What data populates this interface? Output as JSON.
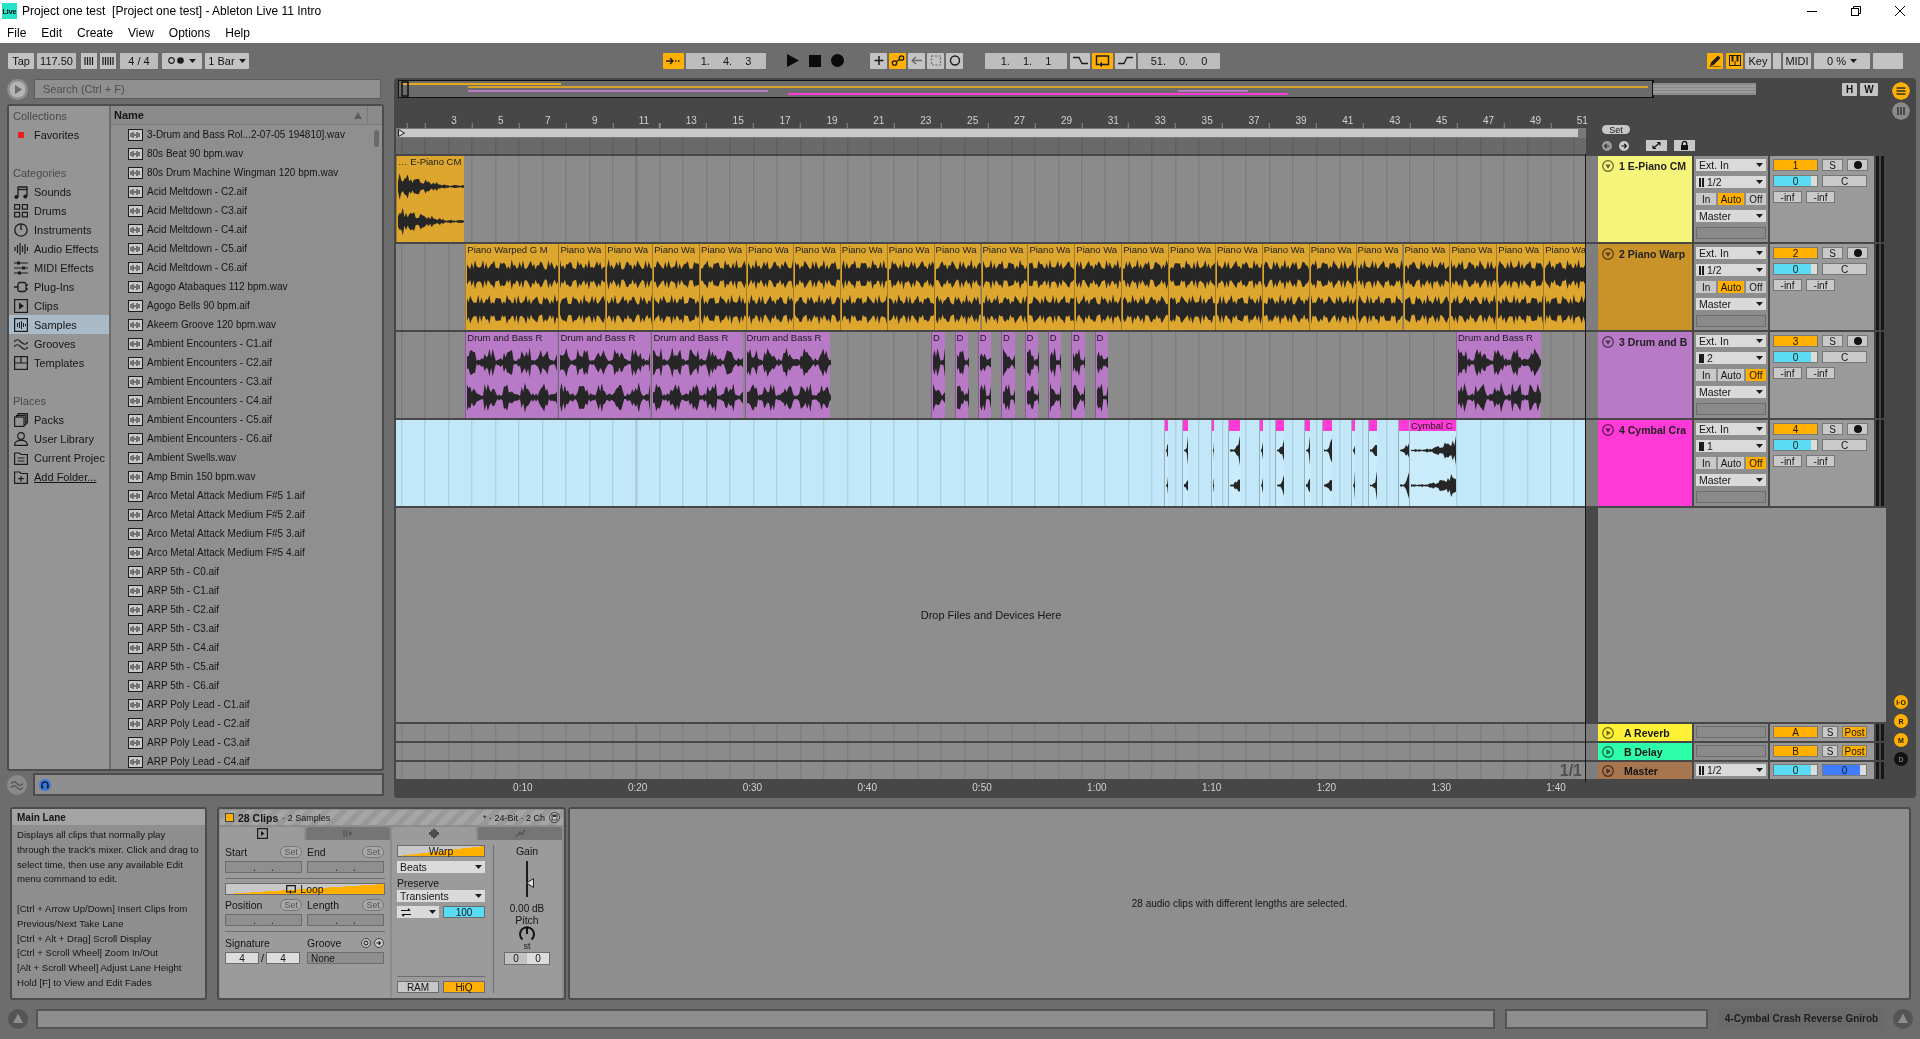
{
  "window": {
    "icon_label": "Live",
    "title": "Project one test  [Project one test] - Ableton Live 11 Intro"
  },
  "menu": [
    "File",
    "Edit",
    "Create",
    "View",
    "Options",
    "Help"
  ],
  "control_bar": {
    "tap": "Tap",
    "tempo": "117.50",
    "signature": "4 / 4",
    "metronome": false,
    "quantization": "1 Bar",
    "follow": true,
    "position": "1. 4. 3",
    "record_options": [
      {
        "kind": "overdub",
        "on": false
      },
      {
        "kind": "automation-arm",
        "on": true
      },
      {
        "kind": "re-enable",
        "on": false
      },
      {
        "kind": "capture",
        "on": false
      },
      {
        "kind": "session-record",
        "on": false
      }
    ],
    "loop_start": "1. 1. 1",
    "punch_in": false,
    "loop": true,
    "punch_out": false,
    "loop_length": "51. 0. 0",
    "draw_mode": true,
    "computer_keyboard": true,
    "key_map": {
      "label": "Key",
      "on": false
    },
    "midi_map": {
      "label": "MIDI",
      "on": false
    },
    "cpu": "0 %"
  },
  "browser": {
    "search": {
      "placeholder": "Search (Ctrl + F)"
    },
    "groups": [
      {
        "heading": "Collections",
        "items": [
          {
            "label": "Favorites",
            "kind": "collection",
            "color": "#ee1c1c",
            "selected": false
          }
        ]
      },
      {
        "heading": "Categories",
        "items": [
          {
            "label": "Sounds",
            "kind": "sounds",
            "selected": false
          },
          {
            "label": "Drums",
            "kind": "drums",
            "selected": false
          },
          {
            "label": "Instruments",
            "kind": "instruments",
            "selected": false
          },
          {
            "label": "Audio Effects",
            "kind": "audio-effects",
            "selected": false
          },
          {
            "label": "MIDI Effects",
            "kind": "midi-effects",
            "selected": false
          },
          {
            "label": "Plug-Ins",
            "kind": "plugins",
            "selected": false
          },
          {
            "label": "Clips",
            "kind": "clips",
            "selected": false
          },
          {
            "label": "Samples",
            "kind": "samples",
            "selected": true
          },
          {
            "label": "Grooves",
            "kind": "grooves",
            "selected": false
          },
          {
            "label": "Templates",
            "kind": "templates",
            "selected": false
          }
        ]
      },
      {
        "heading": "Places",
        "items": [
          {
            "label": "Packs",
            "kind": "packs",
            "selected": false
          },
          {
            "label": "User Library",
            "kind": "user",
            "selected": false
          },
          {
            "label": "Current Projec",
            "kind": "project",
            "selected": false
          },
          {
            "label": "Add Folder...",
            "kind": "add-folder",
            "selected": false
          }
        ]
      }
    ],
    "column": "Name",
    "files": [
      {
        "name": "3-Drum and Bass Rol...2-07-05 194810].wav",
        "selected": false
      },
      {
        "name": "80s Beat 90 bpm.wav",
        "selected": false
      },
      {
        "name": "80s Drum Machine Wingman 120 bpm.wav",
        "selected": false
      },
      {
        "name": "Acid Meltdown - C2.aif",
        "selected": false
      },
      {
        "name": "Acid Meltdown - C3.aif",
        "selected": false
      },
      {
        "name": "Acid Meltdown - C4.aif",
        "selected": false
      },
      {
        "name": "Acid Meltdown - C5.aif",
        "selected": false
      },
      {
        "name": "Acid Meltdown - C6.aif",
        "selected": false
      },
      {
        "name": "Agogo Atabaques 112 bpm.wav",
        "selected": false
      },
      {
        "name": "Agogo Bells 90 bpm.aif",
        "selected": false
      },
      {
        "name": "Akeem Groove 120 bpm.wav",
        "selected": false
      },
      {
        "name": "Ambient Encounters - C1.aif",
        "selected": false
      },
      {
        "name": "Ambient Encounters - C2.aif",
        "selected": false
      },
      {
        "name": "Ambient Encounters - C3.aif",
        "selected": false
      },
      {
        "name": "Ambient Encounters - C4.aif",
        "selected": false
      },
      {
        "name": "Ambient Encounters - C5.aif",
        "selected": false
      },
      {
        "name": "Ambient Encounters - C6.aif",
        "selected": false
      },
      {
        "name": "Ambient Swells.wav",
        "selected": false
      },
      {
        "name": "Amp Bmin 150 bpm.wav",
        "selected": false
      },
      {
        "name": "Arco Metal Attack Medium F#5 1.aif",
        "selected": false
      },
      {
        "name": "Arco Metal Attack Medium F#5 2.aif",
        "selected": false
      },
      {
        "name": "Arco Metal Attack Medium F#5 3.aif",
        "selected": false
      },
      {
        "name": "Arco Metal Attack Medium F#5 4.aif",
        "selected": false
      },
      {
        "name": "ARP 5th - C0.aif",
        "selected": false
      },
      {
        "name": "ARP 5th - C1.aif",
        "selected": false
      },
      {
        "name": "ARP 5th - C2.aif",
        "selected": false
      },
      {
        "name": "ARP 5th - C3.aif",
        "selected": false
      },
      {
        "name": "ARP 5th - C4.aif",
        "selected": false
      },
      {
        "name": "ARP 5th - C5.aif",
        "selected": false
      },
      {
        "name": "ARP 5th - C6.aif",
        "selected": false
      },
      {
        "name": "ARP Poly Lead - C1.aif",
        "selected": false
      },
      {
        "name": "ARP Poly Lead - C2.aif",
        "selected": false
      },
      {
        "name": "ARP Poly Lead - C3.aif",
        "selected": false
      },
      {
        "name": "ARP Poly Lead - C4.aif",
        "selected": false
      }
    ]
  },
  "arrangement": {
    "overview_buttons": [
      "H",
      "W"
    ],
    "set_button": "Set",
    "ruler": [
      "3",
      "5",
      "7",
      "9",
      "11",
      "13",
      "15",
      "17",
      "19",
      "21",
      "23",
      "25",
      "27",
      "29",
      "31",
      "33",
      "35",
      "37",
      "39",
      "41",
      "43",
      "45",
      "47",
      "49",
      "51"
    ],
    "tracks": [
      {
        "name": "1 E-Piano CM",
        "color": "#f7f47c",
        "selected": false,
        "clips": [
          {
            "name": "… E-Piano CM",
            "color": "#dca62f",
            "selected": false
          }
        ],
        "input_type": "Ext. In",
        "input_channel": "1/2",
        "stereo": true,
        "monitor": [
          {
            "label": "In",
            "selected": false
          },
          {
            "label": "Auto",
            "selected": true
          },
          {
            "label": "Off",
            "selected": false
          }
        ],
        "output": "Master",
        "number": "1",
        "active": true,
        "solo": {
          "label": "S",
          "on": false
        },
        "arm": false,
        "volume": {
          "reading": "0",
          "level": 0.85
        },
        "pan": "C",
        "sends": [
          "-inf",
          "-inf"
        ]
      },
      {
        "name": "2 Piano Warp",
        "color": "#c9932a",
        "selected": false,
        "clips": [
          {
            "name": "Piano Warped G M",
            "color": "#dca62f",
            "selected": false
          },
          {
            "name": "Piano Wa",
            "color": "#dca62f",
            "selected": false
          },
          {
            "name": "Piano Wa",
            "color": "#dca62f",
            "selected": false
          },
          {
            "name": "Piano Wa",
            "color": "#dca62f",
            "selected": false
          },
          {
            "name": "Piano Wa",
            "color": "#dca62f",
            "selected": false
          },
          {
            "name": "Piano Wa",
            "color": "#dca62f",
            "selected": false
          },
          {
            "name": "Piano Wa",
            "color": "#dca62f",
            "selected": false
          },
          {
            "name": "Piano Wa",
            "color": "#dca62f",
            "selected": false
          },
          {
            "name": "Piano Wa",
            "color": "#dca62f",
            "selected": false
          },
          {
            "name": "Piano Wa",
            "color": "#dca62f",
            "selected": false
          },
          {
            "name": "Piano Wa",
            "color": "#dca62f",
            "selected": false
          },
          {
            "name": "Piano Wa",
            "color": "#dca62f",
            "selected": false
          },
          {
            "name": "Piano Wa",
            "color": "#dca62f",
            "selected": false
          },
          {
            "name": "Piano Wa",
            "color": "#dca62f",
            "selected": false
          },
          {
            "name": "Piano Wa",
            "color": "#dca62f",
            "selected": false
          },
          {
            "name": "Piano Wa",
            "color": "#dca62f",
            "selected": false
          },
          {
            "name": "Piano Wa",
            "color": "#dca62f",
            "selected": false
          },
          {
            "name": "Piano Wa",
            "color": "#dca62f",
            "selected": false
          },
          {
            "name": "Piano Wa",
            "color": "#dca62f",
            "selected": false
          },
          {
            "name": "Piano Wa",
            "color": "#dca62f",
            "selected": false
          },
          {
            "name": "Piano Wa",
            "color": "#dca62f",
            "selected": false
          },
          {
            "name": "Piano Wa",
            "color": "#dca62f",
            "selected": false
          },
          {
            "name": "Piano Wa",
            "color": "#dca62f",
            "selected": false
          }
        ],
        "input_type": "Ext. In",
        "input_channel": "1/2",
        "stereo": true,
        "monitor": [
          {
            "label": "In",
            "selected": false
          },
          {
            "label": "Auto",
            "selected": true
          },
          {
            "label": "Off",
            "selected": false
          }
        ],
        "output": "Master",
        "number": "2",
        "active": true,
        "solo": {
          "label": "S",
          "on": false
        },
        "arm": false,
        "volume": {
          "reading": "0",
          "level": 0.85
        },
        "pan": "C",
        "sends": [
          "-inf",
          "-inf"
        ]
      },
      {
        "name": "3 Drum and B",
        "color": "#b879c6",
        "selected": false,
        "clips": [
          {
            "name": "Drum and Bass R",
            "color": "#b879c6",
            "selected": false
          },
          {
            "name": "Drum and Bass R",
            "color": "#b879c6",
            "selected": false
          },
          {
            "name": "Drum and Bass R",
            "color": "#b879c6",
            "selected": false
          },
          {
            "name": "Drum and Bass R",
            "color": "#b879c6",
            "selected": false
          },
          {
            "name": "D",
            "color": "#b879c6",
            "selected": false
          },
          {
            "name": "D",
            "color": "#b879c6",
            "selected": false
          },
          {
            "name": "D",
            "color": "#b879c6",
            "selected": false
          },
          {
            "name": "D",
            "color": "#b879c6",
            "selected": false
          },
          {
            "name": "D",
            "color": "#b879c6",
            "selected": false
          },
          {
            "name": "D",
            "color": "#b879c6",
            "selected": false
          },
          {
            "name": "D",
            "color": "#b879c6",
            "selected": false
          },
          {
            "name": "D",
            "color": "#b879c6",
            "selected": false
          },
          {
            "name": "Drum and Bass R",
            "color": "#b879c6",
            "selected": false
          }
        ],
        "input_type": "Ext. In",
        "input_channel": "2",
        "stereo": false,
        "monitor": [
          {
            "label": "In",
            "selected": false
          },
          {
            "label": "Auto",
            "selected": false
          },
          {
            "label": "Off",
            "selected": true
          }
        ],
        "output": "Master",
        "number": "3",
        "active": true,
        "solo": {
          "label": "S",
          "on": false
        },
        "arm": false,
        "volume": {
          "reading": "0",
          "level": 0.85
        },
        "pan": "C",
        "sends": [
          "-inf",
          "-inf"
        ]
      },
      {
        "name": "4 Cymbal Cra",
        "color": "#ff3ad6",
        "selected": true,
        "clips": [
          {
            "color": "#ff3ad6",
            "selected": true
          },
          {
            "color": "#ff3ad6",
            "selected": true
          },
          {
            "color": "#ff3ad6",
            "selected": true
          },
          {
            "color": "#ff3ad6",
            "selected": true
          },
          {
            "color": "#ff3ad6",
            "selected": true
          },
          {
            "color": "#ff3ad6",
            "selected": true
          },
          {
            "color": "#ff3ad6",
            "selected": true
          },
          {
            "color": "#ff3ad6",
            "selected": true
          },
          {
            "color": "#ff3ad6",
            "selected": true
          },
          {
            "color": "#ff3ad6",
            "selected": true
          },
          {
            "color": "#ff3ad6",
            "selected": true
          },
          {
            "name": "Cymbal C",
            "color": "#ff3ad6",
            "selected": true
          }
        ],
        "input_type": "Ext. In",
        "input_channel": "1",
        "stereo": false,
        "monitor": [
          {
            "label": "In",
            "selected": false
          },
          {
            "label": "Auto",
            "selected": false
          },
          {
            "label": "Off",
            "selected": true
          }
        ],
        "output": "Master",
        "number": "4",
        "active": true,
        "solo": {
          "label": "S",
          "on": false
        },
        "arm": false,
        "volume": {
          "reading": "0",
          "level": 0.85
        },
        "pan": "C",
        "sends": [
          "-inf",
          "-inf"
        ]
      }
    ],
    "drop_hint": "Drop Files and Devices Here",
    "zoom_label": "1/1",
    "returns": [
      {
        "name": "A Reverb",
        "color": "#fff236",
        "letter": "A",
        "active": true,
        "solo": {
          "label": "S",
          "on": false
        },
        "send_mode": {
          "label": "Post",
          "on": true
        }
      },
      {
        "name": "B Delay",
        "color": "#2efdaa",
        "letter": "B",
        "active": true,
        "solo": {
          "label": "S",
          "on": false
        },
        "send_mode": {
          "label": "Post",
          "on": true
        }
      }
    ],
    "master": {
      "name": "Master",
      "color": "#a8764e",
      "output": "1/2",
      "stereo": true,
      "volume": {
        "reading": "0",
        "level": 0.85
      },
      "cue": {
        "reading": "0",
        "level": 0.85
      }
    },
    "time_ruler": [
      "0:10",
      "0:20",
      "0:30",
      "0:40",
      "0:50",
      "1:00",
      "1:10",
      "1:20",
      "1:30",
      "1:40"
    ],
    "views": [
      {
        "kind": "arrangement",
        "selected": true
      },
      {
        "kind": "session",
        "selected": false
      }
    ],
    "section_toggles": [
      {
        "label": "I·O",
        "on": true
      },
      {
        "label": "R",
        "on": true
      },
      {
        "label": "M",
        "on": true
      },
      {
        "label": "D",
        "on": false
      }
    ]
  },
  "info_view": {
    "title": "Main Lane",
    "paragraphs": [
      "Displays all clips that normally play through the track's mixer. Click and drag to select time, then use any available Edit menu command to edit.",
      "[Ctrl + Arrow Up/Down] Insert Clips from Previous/Next Take Lane",
      "[Ctrl + Alt + Drag] Scroll Display",
      "[Ctrl + Scroll Wheel] Zoom In/Out",
      "[Alt + Scroll Wheel] Adjust Lane Height",
      "Hold [F] to View and Edit Fades"
    ]
  },
  "clip_view": {
    "color": "#ffb000",
    "title": "28 Clips",
    "subtitle": "· 2 Samples",
    "format": "* · 24-Bit · 2 Ch",
    "tabs": [
      {
        "kind": "clip",
        "selected": true
      },
      {
        "kind": "launch",
        "selected": false
      },
      {
        "kind": "audio",
        "selected": true
      },
      {
        "kind": "envelopes",
        "selected": false
      }
    ],
    "start": {
      "label": "Start",
      "button": "Set",
      "value": ". ."
    },
    "end": {
      "label": "End",
      "button": "Set",
      "value": ". ."
    },
    "loop": {
      "label": "Loop",
      "mixed": true
    },
    "position": {
      "label": "Position",
      "button": "Set",
      "value": ". ."
    },
    "length": {
      "label": "Length",
      "button": "Set",
      "value": ". ."
    },
    "signature": {
      "label": "Signature",
      "numerator": "4",
      "separator": "/",
      "denominator": "4"
    },
    "groove": {
      "label": "Groove",
      "value": "None"
    },
    "warp": {
      "label": "Warp",
      "mixed": true
    },
    "warp_mode": "Beats",
    "preserve": {
      "label": "Preserve",
      "value": "Transients"
    },
    "envelope": "100",
    "ram": {
      "label": "RAM",
      "on": false
    },
    "hiq": {
      "label": "HiQ",
      "on": true
    },
    "gain": {
      "label": "Gain",
      "level": 0.4,
      "reading": "0.00 dB"
    },
    "pitch": {
      "label": "Pitch",
      "unit": "st",
      "coarse": "0",
      "fine": "0"
    }
  },
  "detail_message": "28 audio clips with different lengths are selected.",
  "status_bar": {
    "selected_track": "4-Cymbal Crash Reverse Gnirob"
  }
}
